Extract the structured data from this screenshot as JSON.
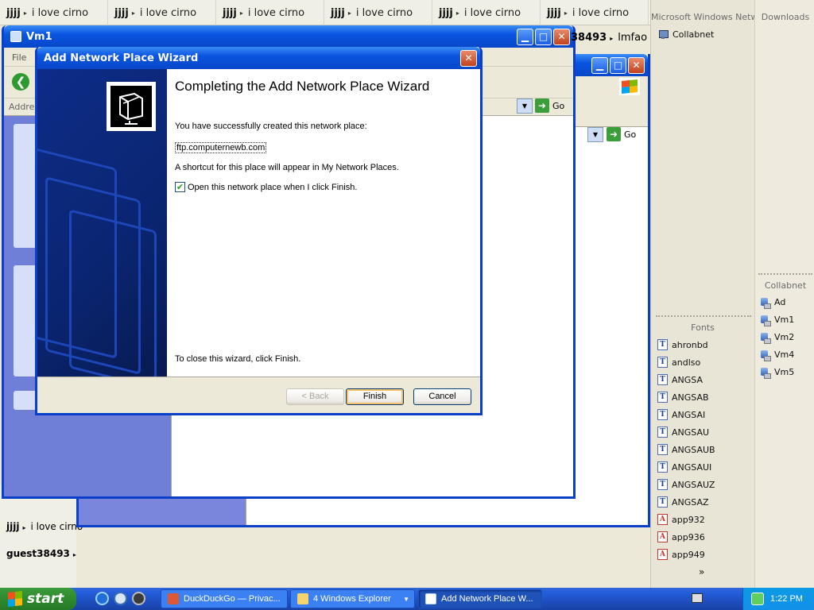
{
  "chat_tabs": [
    {
      "user": "jjjj",
      "text": "i love cirno"
    },
    {
      "user": "jjjj",
      "text": "i love cirno"
    },
    {
      "user": "jjjj",
      "text": "i love cirno"
    },
    {
      "user": "jjjj",
      "text": "i love cirno"
    },
    {
      "user": "jjjj",
      "text": "i love cirno"
    },
    {
      "user": "jjjj",
      "text": "i love cirno"
    }
  ],
  "chat_right_fragment": {
    "user": "38493",
    "text": "lmfao"
  },
  "left_chat": [
    {
      "user": "jjjj",
      "text": "i love cirno"
    },
    {
      "user": "guest38493",
      "text": ""
    }
  ],
  "window_vm1": {
    "title": "Vm1",
    "menu_file": "File",
    "address_label": "Addres",
    "go_label": "Go"
  },
  "window_back": {
    "go_label": "Go"
  },
  "wizard": {
    "title": "Add Network Place Wizard",
    "heading": "Completing the Add Network Place Wizard",
    "created_text": "You have successfully created this network place:",
    "place_url": "ftp.computernewb.com",
    "shortcut_text": "A shortcut for this place will appear in My Network Places.",
    "open_checkbox_label": "Open this network place when I click Finish.",
    "open_checked": true,
    "close_text": "To close this wizard, click Finish.",
    "back_label": "< Back",
    "finish_label": "Finish",
    "cancel_label": "Cancel"
  },
  "right_panels": {
    "ms_network_header": "Microsoft Windows Network",
    "collabnet_item": "Collabnet",
    "downloads_header": "Downloads",
    "collabnet_header": "Collabnet",
    "computers": [
      "Ad",
      "Vm1",
      "Vm2",
      "Vm4",
      "Vm5"
    ],
    "fonts_header": "Fonts",
    "fonts": [
      {
        "name": "ahronbd",
        "type": "truetype"
      },
      {
        "name": "andlso",
        "type": "truetype"
      },
      {
        "name": "ANGSA",
        "type": "truetype"
      },
      {
        "name": "ANGSAB",
        "type": "truetype"
      },
      {
        "name": "ANGSAI",
        "type": "truetype"
      },
      {
        "name": "ANGSAU",
        "type": "truetype"
      },
      {
        "name": "ANGSAUB",
        "type": "truetype"
      },
      {
        "name": "ANGSAUI",
        "type": "truetype"
      },
      {
        "name": "ANGSAUZ",
        "type": "truetype"
      },
      {
        "name": "ANGSAZ",
        "type": "truetype"
      },
      {
        "name": "app932",
        "type": "opentype"
      },
      {
        "name": "app936",
        "type": "opentype"
      },
      {
        "name": "app949",
        "type": "opentype"
      }
    ],
    "more_indicator": "»"
  },
  "taskbar": {
    "start_label": "start",
    "tasks": [
      {
        "label": "DuckDuckGo — Privac...",
        "active": false
      },
      {
        "label": "4 Windows Explorer",
        "active": false
      },
      {
        "label": "Add Network Place W...",
        "active": true
      }
    ],
    "clock": "1:22 PM"
  },
  "colors": {
    "xp_blue": "#0a3fc9",
    "taskbar_blue": "#245edb",
    "start_green": "#2d8a2d",
    "wizard_side": "#0a2570"
  }
}
